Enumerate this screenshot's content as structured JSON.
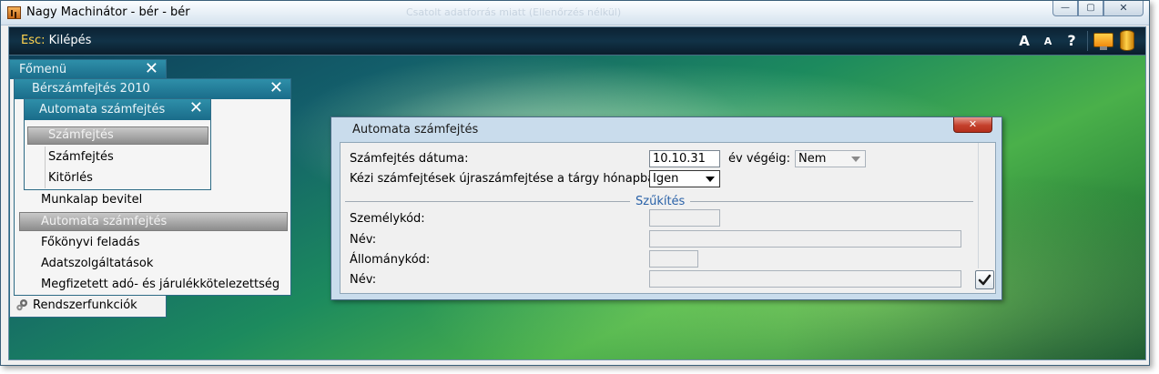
{
  "window": {
    "title": "Nagy Machinátor - bér - bér",
    "ghost_title": "Csatolt adatforrás miatt (Ellenőrzés nélkül)",
    "buttons": {
      "minimize": "—",
      "maximize": "▢",
      "close": "✕"
    }
  },
  "toolbar": {
    "esc_key": "Esc:",
    "esc_label": "Kilépés",
    "font_larger": "A",
    "font_smaller": "A",
    "help": "?",
    "icons": [
      "monitor-icon",
      "database-icon"
    ]
  },
  "main_menu": {
    "title": "Főmenü",
    "close": "✕",
    "items": [
      {
        "label": "Rendszerfunkciók",
        "icon": "gears-icon"
      }
    ]
  },
  "payroll_menu": {
    "title": "Bérszámfejtés 2010",
    "close": "✕",
    "items": [
      {
        "label": "Munkalap bevitel"
      },
      {
        "label": "Automata számfejtés",
        "selected": true
      },
      {
        "label": "Főkönyvi feladás"
      },
      {
        "label": "Adatszolgáltatások"
      },
      {
        "label": "Megfizetett adó- és járulékkötelezettség"
      }
    ]
  },
  "auto_menu": {
    "title": "Automata számfejtés",
    "close": "✕",
    "items": [
      {
        "label": "Számfejtés",
        "selected": true
      },
      {
        "label": "Számfejtés"
      },
      {
        "label": "Kitörlés"
      }
    ]
  },
  "dialog": {
    "title": "Automata számfejtés",
    "close": "✕",
    "fields": {
      "date_label": "Számfejtés dátuma:",
      "date_value": "10.10.31",
      "year_end_label": "év végéig:",
      "year_end_value": "Nem",
      "recalc_label": "Kézi számfejtések újraszámfejtése a tárgy hónapban:",
      "recalc_value": "Igen"
    },
    "section_title": "Szűkítés",
    "filters": {
      "person_code_label": "Személykód:",
      "person_code_value": "",
      "name1_label": "Név:",
      "name1_value": "",
      "staff_code_label": "Állománykód:",
      "staff_code_value": "",
      "name2_label": "Név:",
      "name2_value": ""
    },
    "ok_icon": "checkmark-icon"
  }
}
